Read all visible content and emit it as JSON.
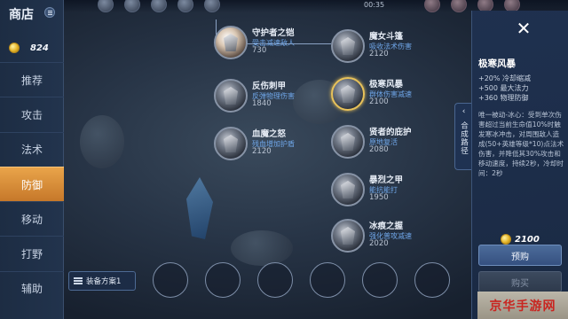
{
  "top": {
    "timer": "00:35"
  },
  "shop": {
    "title": "商店",
    "gold": "824",
    "categories": [
      {
        "label": "推荐",
        "active": false
      },
      {
        "label": "攻击",
        "active": false
      },
      {
        "label": "法术",
        "active": false
      },
      {
        "label": "防御",
        "active": true
      },
      {
        "label": "移动",
        "active": false
      },
      {
        "label": "打野",
        "active": false
      },
      {
        "label": "辅助",
        "active": false
      }
    ]
  },
  "items": [
    {
      "name": "守护者之铠",
      "desc": "受击减速敌人",
      "price": "730"
    },
    {
      "name": "反伤刺甲",
      "desc": "反弹物理伤害",
      "price": "1840"
    },
    {
      "name": "血魔之怒",
      "desc": "残血增加护盾",
      "price": "2120"
    },
    {
      "name": "魔女斗篷",
      "desc": "吸收法术伤害",
      "price": "2120"
    },
    {
      "name": "极寒风暴",
      "desc": "群体伤害减速",
      "price": "2100"
    },
    {
      "name": "贤者的庇护",
      "desc": "原地复活",
      "price": "2080"
    },
    {
      "name": "暴烈之甲",
      "desc": "能抗能打",
      "price": "1950"
    },
    {
      "name": "冰痕之握",
      "desc": "强化普攻减速",
      "price": "2020"
    }
  ],
  "detail": {
    "title": "极寒风暴",
    "stats": [
      "+20% 冷却缩减",
      "+500 最大法力",
      "+360 物理防御"
    ],
    "passive": "唯一被动-冰心：受到单次伤害超过当前生命值10%时触发寒冰冲击，对周围敌人造成(50+英雄等级*10)点法术伤害，并降低其30%攻击和移动速度，持续2秒，冷却时间：2秒",
    "price": "2100",
    "reserve_label": "预购",
    "buy_label": "购买",
    "close_icon": "✕"
  },
  "synth_tab": {
    "label": "合成路径",
    "arrow": "‹"
  },
  "bottom": {
    "plan_label": "装备方案1"
  },
  "watermark": "京华手游网"
}
